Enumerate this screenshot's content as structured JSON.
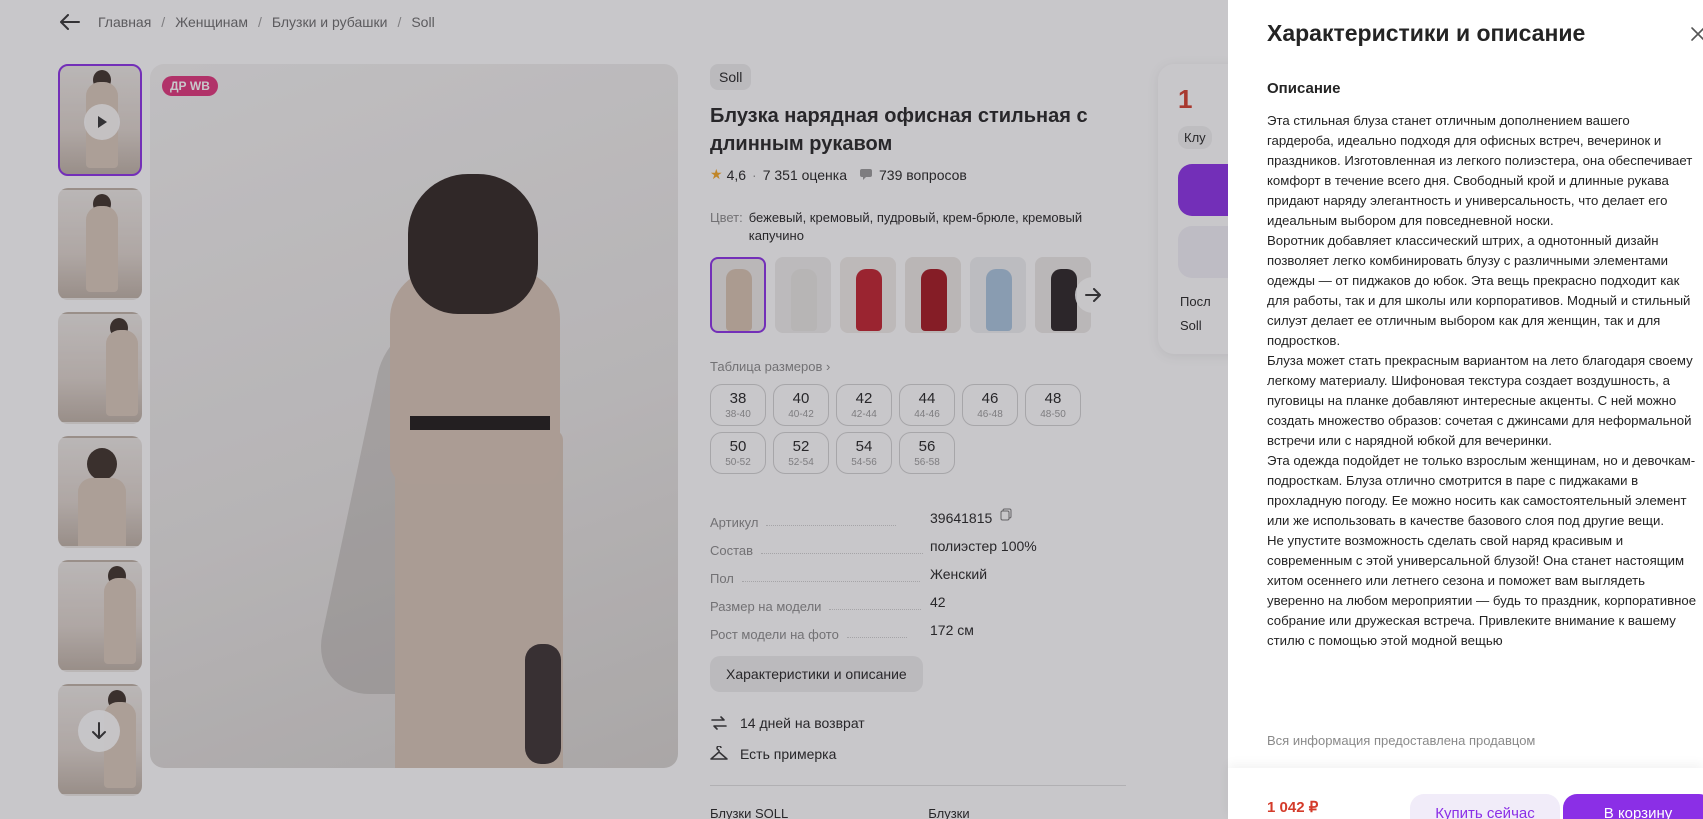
{
  "breadcrumbs": [
    "Главная",
    "Женщинам",
    "Блузки и рубашки",
    "Soll"
  ],
  "badge": "ДР WB",
  "product": {
    "brand": "Soll",
    "title": "Блузка нарядная офисная стильная с длинным рукавом",
    "rating": "4,6",
    "reviews": "7 351 оценка",
    "questions": "739 вопросов",
    "color_label": "Цвет:",
    "colors": "бежевый, кремовый, пудровый, крем-брюле, кремовый капучино",
    "swatch_colors": [
      "#d8c3b0",
      "#e8e6e2",
      "#c0202d",
      "#a3171f",
      "#a9c4dd",
      "#2a2324"
    ],
    "size_table_link": "Таблица размеров",
    "sizes": [
      {
        "size": "38",
        "range": "38-40"
      },
      {
        "size": "40",
        "range": "40-42"
      },
      {
        "size": "42",
        "range": "42-44"
      },
      {
        "size": "44",
        "range": "44-46"
      },
      {
        "size": "46",
        "range": "46-48"
      },
      {
        "size": "48",
        "range": "48-50"
      },
      {
        "size": "50",
        "range": "50-52"
      },
      {
        "size": "52",
        "range": "52-54"
      },
      {
        "size": "54",
        "range": "54-56"
      },
      {
        "size": "56",
        "range": "56-58"
      }
    ],
    "specs": [
      {
        "key": "Артикул",
        "value": "39641815"
      },
      {
        "key": "Состав",
        "value": "полиэстер 100%"
      },
      {
        "key": "Пол",
        "value": "Женский"
      },
      {
        "key": "Размер на модели",
        "value": "42"
      },
      {
        "key": "Рост модели на фото",
        "value": "172 см"
      }
    ],
    "char_button": "Характеристики и описание",
    "return_text": "14 дней на возврат",
    "fitting_text": "Есть примерка",
    "bottom_links": [
      "Блузки SOLL",
      "Блузки"
    ]
  },
  "buy_card": {
    "price_partial": "1",
    "club_partial": "Клу",
    "line1_partial": "Посл",
    "line2_partial": "Soll"
  },
  "panel": {
    "title": "Характеристики и описание",
    "desc_heading": "Описание",
    "description": "Эта стильная блуза станет отличным дополнением вашего гардероба, идеально подходя для офисных встреч, вечеринок и праздников. Изготовленная из легкого полиэстера, она обеспечивает комфорт в течение всего дня. Свободный крой и длинные рукава придают наряду элегантность и универсальность, что делает его идеальным выбором для повседневной носки.\nВоротник добавляет классический штрих, а однотонный дизайн позволяет легко комбинировать блузу с различными элементами одежды — от пиджаков до юбок. Эта вещь прекрасно подходит как для работы, так и для школы или корпоративов. Модный и стильный силуэт делает ее отличным выбором как для женщин, так и для подростков.\nБлуза может стать прекрасным вариантом на лето благодаря своему легкому материалу. Шифоновая текстура создает воздушность, а пуговицы на планке добавляют интересные акценты. С ней можно создать множество образов: сочетая с джинсами для неформальной встречи или с нарядной юбкой для вечеринки.\nЭта одежда подойдет не только взрослым женщинам, но и девочкам-подросткам. Блуза отлично смотрится в паре с пиджаками в прохладную погоду. Ее можно носить как самостоятельный элемент или же использовать в качестве базового слоя под другие вещи.\nНе упустите возможность сделать свой наряд красивым и современным с этой универсальной блузой! Она станет настоящим хитом осеннего или летнего сезона и поможет вам выглядеть уверенно на любом мероприятии — будь то праздник, корпоративное собрание или дружеская встреча. Привлеките внимание к вашему стилю с помощью этой модной вещью",
    "seller_note": "Вся информация предоставлена продавцом",
    "price": "1 042 ₽",
    "buy_now": "Купить сейчас",
    "add_to_cart": "В корзину"
  },
  "colors": {
    "accent": "#8b2fe6",
    "price": "#d43b2a",
    "badge": "#e0337a"
  }
}
